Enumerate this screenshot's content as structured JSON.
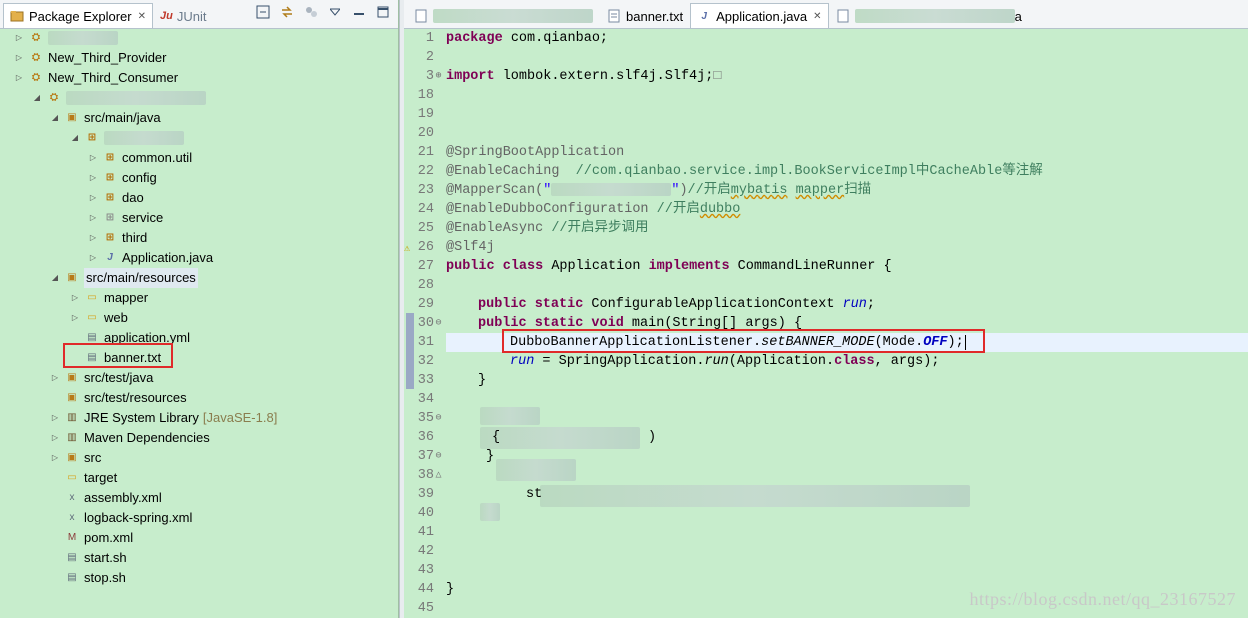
{
  "left_panel": {
    "tabs": [
      {
        "label": "Package Explorer",
        "close": "✕",
        "icon": "package-explorer-icon"
      },
      {
        "label": "JUnit",
        "prefix": "Ju",
        "icon": "junit-icon"
      }
    ],
    "tree": [
      {
        "label": "New_Third_Provider",
        "icon": "project"
      },
      {
        "label": "New_Third_Consumer",
        "icon": "project"
      },
      {
        "label": "src/main/java",
        "icon": "src"
      },
      {
        "label": "common.util",
        "icon": "pkg"
      },
      {
        "label": "config",
        "icon": "pkg"
      },
      {
        "label": "dao",
        "icon": "pkg"
      },
      {
        "label": "service",
        "icon": "pkg"
      },
      {
        "label": "third",
        "icon": "pkg"
      },
      {
        "label": "Application.java",
        "icon": "java"
      },
      {
        "label": "src/main/resources",
        "icon": "src"
      },
      {
        "label": "mapper",
        "icon": "folder"
      },
      {
        "label": "web",
        "icon": "folder"
      },
      {
        "label": "application.yml",
        "icon": "file"
      },
      {
        "label": "banner.txt",
        "icon": "file"
      },
      {
        "label": "src/test/java",
        "icon": "src"
      },
      {
        "label": "src/test/resources",
        "icon": "src"
      },
      {
        "label": "JRE System Library",
        "suffix": "[JavaSE-1.8]",
        "icon": "lib"
      },
      {
        "label": "Maven Dependencies",
        "icon": "lib"
      },
      {
        "label": "src",
        "icon": "src"
      },
      {
        "label": "target",
        "icon": "folder"
      },
      {
        "label": "assembly.xml",
        "icon": "xml"
      },
      {
        "label": "logback-spring.xml",
        "icon": "xml"
      },
      {
        "label": "pom.xml",
        "icon": "maven"
      },
      {
        "label": "start.sh",
        "icon": "file"
      },
      {
        "label": "stop.sh",
        "icon": "file"
      }
    ]
  },
  "editor": {
    "tabs": [
      {
        "label": "banner.txt"
      },
      {
        "label": "Application.java",
        "close": "✕",
        "active": true
      },
      {
        "label": "a"
      }
    ],
    "line_numbers": [
      "1",
      "2",
      "3",
      "18",
      "19",
      "20",
      "21",
      "22",
      "23",
      "24",
      "25",
      "26",
      "27",
      "28",
      "29",
      "30",
      "31",
      "32",
      "33",
      "34",
      "35",
      "36",
      "37",
      "38",
      "39",
      "40",
      "41",
      "42",
      "43",
      "44",
      "45"
    ],
    "code": {
      "l1_kw": "package",
      "l1_rest": " com.qianbao;",
      "l3_kw": "import",
      "l3_rest": " lombok.extern.slf4j.Slf4j;",
      "l3_box": "□",
      "l21": "@SpringBootApplication",
      "l22_an": "@EnableCaching",
      "l22_cm": "  //com.qianbao.service.impl.BookServiceImpl中CacheAble等注解",
      "l23_an": "@MapperScan(",
      "l23_q1": "\"",
      "l23_q2": "\"",
      "l23_close": ")",
      "l23_cm1": "//开启",
      "l23_cm2": "mybatis",
      "l23_cm3": " ",
      "l23_cm4": "mapper",
      "l23_cm5": "扫描",
      "l24_an": "@EnableDubboConfiguration",
      "l24_cm1": " //开启",
      "l24_cm2": "dubbo",
      "l25_an": "@EnableAsync",
      "l25_cm": " //开启异步调用",
      "l26": "@Slf4j",
      "l27_kw1": "public",
      "l27_kw2": "class",
      "l27_name": " Application ",
      "l27_kw3": "implements",
      "l27_rest": " CommandLineRunner {",
      "l29_kw": "public static",
      "l29_type": " ConfigurableApplicationContext ",
      "l29_fld": "run",
      "l29_end": ";",
      "l30_kw": "public static void",
      "l30_rest": " main(String[] args) {",
      "l31_a": "DubboBannerApplicationListener.",
      "l31_b": "setBANNER_MODE",
      "l31_c": "(Mode.",
      "l31_d": "OFF",
      "l31_e": ");",
      "l32_fld": "run",
      "l32_a": " = SpringApplication.",
      "l32_b": "run",
      "l32_c": "(Application.",
      "l32_kw": "class",
      "l32_d": ", args);",
      "l33": "}",
      "l36_a": "{",
      "l36_b": ")",
      "l37": "}",
      "l39": "st",
      "l44": "}"
    },
    "watermark": "https://blog.csdn.net/qq_23167527"
  }
}
